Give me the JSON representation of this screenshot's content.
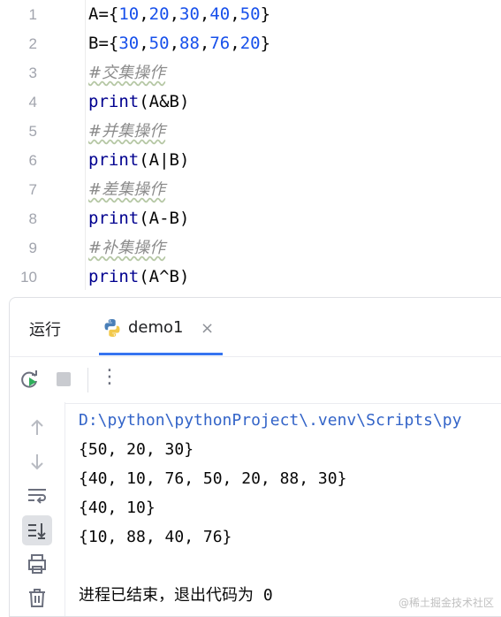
{
  "editor": {
    "lines": [
      {
        "n": "1",
        "tokens": [
          {
            "t": "A={",
            "c": "plain"
          },
          {
            "t": "10",
            "c": "num"
          },
          {
            "t": ",",
            "c": "plain"
          },
          {
            "t": "20",
            "c": "num"
          },
          {
            "t": ",",
            "c": "plain"
          },
          {
            "t": "30",
            "c": "num"
          },
          {
            "t": ",",
            "c": "plain"
          },
          {
            "t": "40",
            "c": "num"
          },
          {
            "t": ",",
            "c": "plain"
          },
          {
            "t": "50",
            "c": "num"
          },
          {
            "t": "}",
            "c": "plain"
          }
        ]
      },
      {
        "n": "2",
        "tokens": [
          {
            "t": "B={",
            "c": "plain"
          },
          {
            "t": "30",
            "c": "num"
          },
          {
            "t": ",",
            "c": "plain"
          },
          {
            "t": "50",
            "c": "num"
          },
          {
            "t": ",",
            "c": "plain"
          },
          {
            "t": "88",
            "c": "num"
          },
          {
            "t": ",",
            "c": "plain"
          },
          {
            "t": "76",
            "c": "num"
          },
          {
            "t": ",",
            "c": "plain"
          },
          {
            "t": "20",
            "c": "num"
          },
          {
            "t": "}",
            "c": "plain"
          }
        ]
      },
      {
        "n": "3",
        "tokens": [
          {
            "t": "#交集操作",
            "c": "cmt"
          }
        ]
      },
      {
        "n": "4",
        "tokens": [
          {
            "t": "print",
            "c": "kw"
          },
          {
            "t": "(A&B)",
            "c": "plain"
          }
        ]
      },
      {
        "n": "5",
        "tokens": [
          {
            "t": "#并集操作",
            "c": "cmt"
          }
        ]
      },
      {
        "n": "6",
        "tokens": [
          {
            "t": "print",
            "c": "kw"
          },
          {
            "t": "(A|B)",
            "c": "plain"
          }
        ]
      },
      {
        "n": "7",
        "tokens": [
          {
            "t": "#差集操作",
            "c": "cmt"
          }
        ]
      },
      {
        "n": "8",
        "tokens": [
          {
            "t": "print",
            "c": "kw"
          },
          {
            "t": "(A-B)",
            "c": "plain"
          }
        ]
      },
      {
        "n": "9",
        "tokens": [
          {
            "t": "#补集操作",
            "c": "cmt"
          }
        ]
      },
      {
        "n": "10",
        "tokens": [
          {
            "t": "print",
            "c": "kw"
          },
          {
            "t": "(A^B)",
            "c": "plain"
          }
        ]
      }
    ]
  },
  "run_panel": {
    "title": "运行",
    "tab": {
      "label": "demo1",
      "icon": "python-icon",
      "close_glyph": "×"
    },
    "toolbar": {
      "rerun_icon": "rerun-icon",
      "stop_icon": "stop-icon",
      "more_glyph": "⋮"
    },
    "gutter_icons": [
      "arrow-up-icon",
      "arrow-down-icon",
      "soft-wrap-icon",
      "scroll-to-end-icon",
      "print-icon",
      "trash-icon"
    ],
    "console": {
      "command": "D:\\python\\pythonProject\\.venv\\Scripts\\py",
      "outputs": [
        "{50, 20, 30}",
        "{40, 10, 76, 50, 20, 88, 30}",
        "{40, 10}",
        "{10, 88, 40, 76}"
      ],
      "exit_message": "进程已结束，退出代码为 0"
    }
  },
  "colors": {
    "keyword": "#00008f",
    "number": "#1750eb",
    "comment": "#8c8c8c",
    "accent": "#3574f0",
    "path": "#3364c8"
  },
  "watermark": "@稀土掘金技术社区"
}
